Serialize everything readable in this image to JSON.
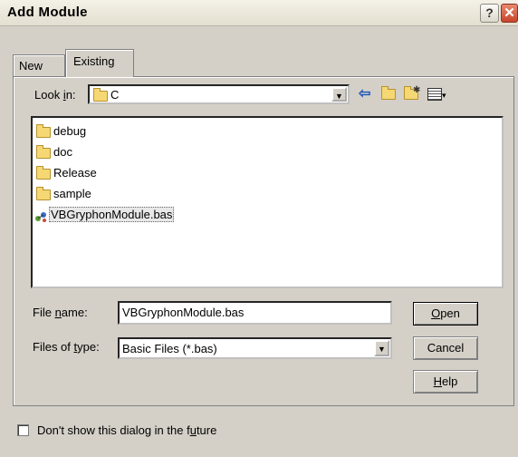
{
  "window": {
    "title": "Add Module",
    "help_glyph": "?",
    "close_glyph": "✕"
  },
  "tabs": [
    {
      "label": "New"
    },
    {
      "label": "Existing"
    }
  ],
  "look_in": {
    "label_pre": "Look ",
    "label_key": "i",
    "label_post": "n:",
    "value": "C"
  },
  "files": [
    {
      "name": "debug",
      "type": "folder"
    },
    {
      "name": "doc",
      "type": "folder"
    },
    {
      "name": "Release",
      "type": "folder"
    },
    {
      "name": "sample",
      "type": "folder"
    },
    {
      "name": "VBGryphonModule.bas",
      "type": "bas",
      "selected": true
    }
  ],
  "file_name": {
    "label_pre": "File ",
    "label_key": "n",
    "label_post": "ame:",
    "value": "VBGryphonModule.bas"
  },
  "files_of_type": {
    "label_pre": "Files of ",
    "label_key": "t",
    "label_post": "ype:",
    "value": "Basic Files (*.bas)"
  },
  "buttons": {
    "open_key": "O",
    "open_rest": "pen",
    "cancel": "Cancel",
    "help_key": "H",
    "help_rest": "elp"
  },
  "dont_show": {
    "pre": "Don't show this dialog in the f",
    "key": "u",
    "post": "ture"
  },
  "toolbar_icons": [
    "back-icon",
    "up-folder-icon",
    "new-folder-icon",
    "view-menu-icon"
  ]
}
